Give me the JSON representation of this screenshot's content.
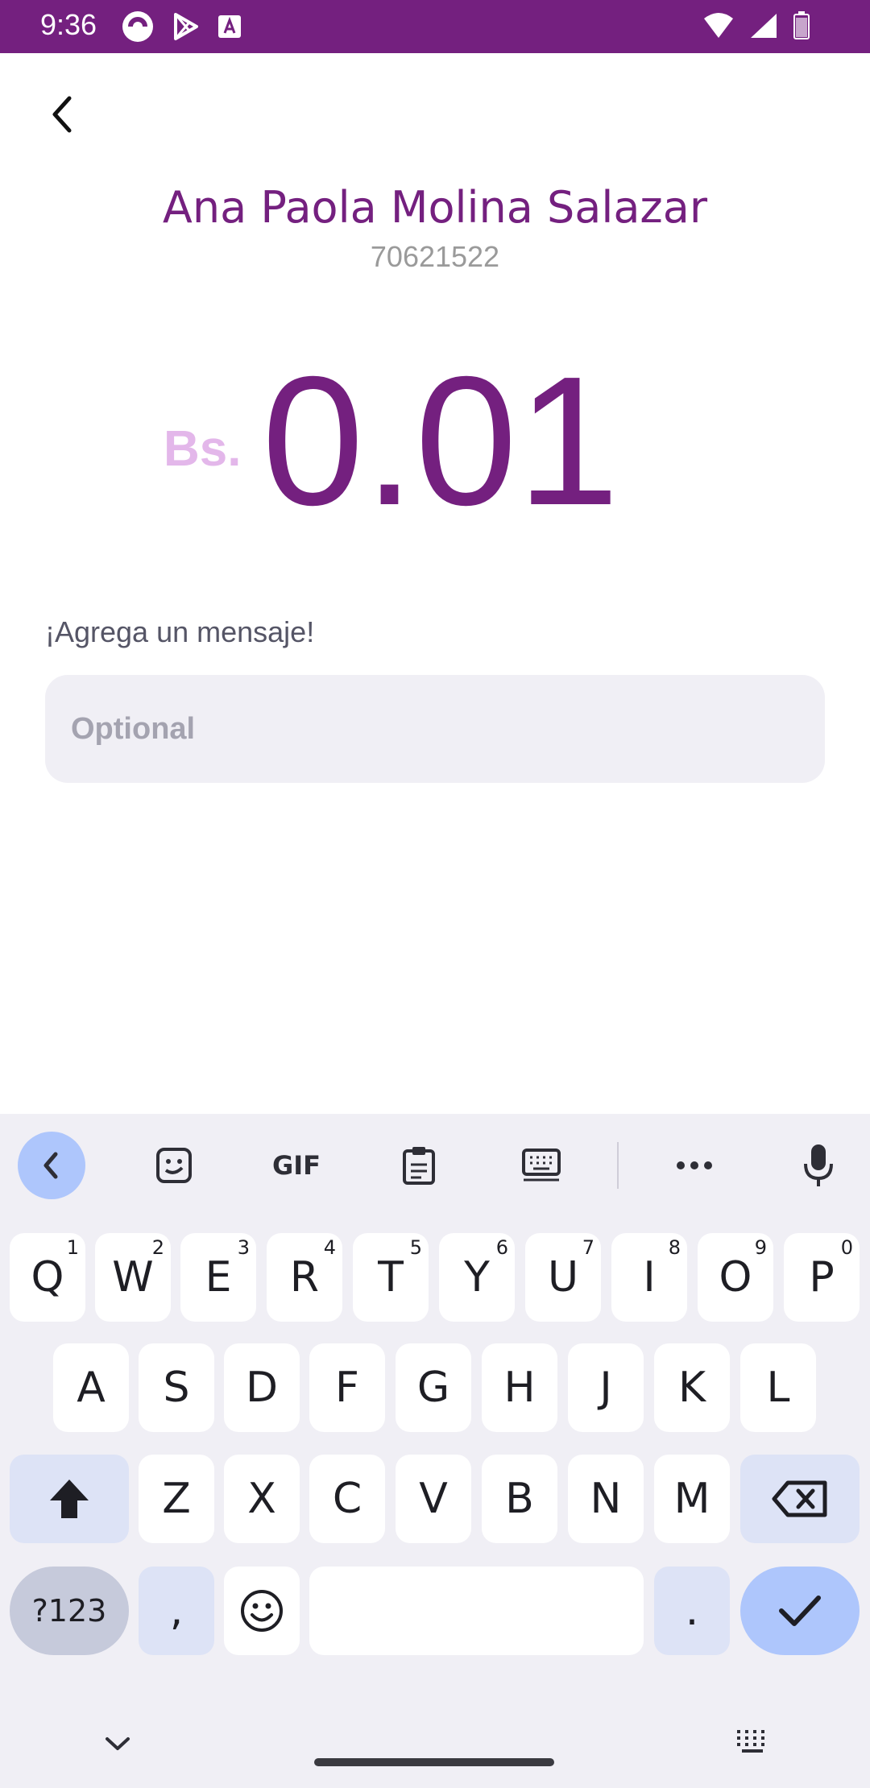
{
  "status_bar": {
    "time": "9:36",
    "bg_color": "#74207f"
  },
  "header": {
    "back_icon": "chevron-left-icon"
  },
  "recipient": {
    "name": "Ana Paola Molina Salazar",
    "phone": "70621522"
  },
  "amount": {
    "currency": "Bs.",
    "value": "0.01"
  },
  "message": {
    "label": "¡Agrega un mensaje!",
    "placeholder": "Optional",
    "value": ""
  },
  "keyboard": {
    "toolbar": [
      "back-icon",
      "sticker-icon",
      "gif-icon",
      "clipboard-icon",
      "keyboard-layout-icon",
      "more-icon",
      "mic-icon"
    ],
    "gif_label": "GIF",
    "row1": [
      {
        "key": "Q",
        "hint": "1"
      },
      {
        "key": "W",
        "hint": "2"
      },
      {
        "key": "E",
        "hint": "3"
      },
      {
        "key": "R",
        "hint": "4"
      },
      {
        "key": "T",
        "hint": "5"
      },
      {
        "key": "Y",
        "hint": "6"
      },
      {
        "key": "U",
        "hint": "7"
      },
      {
        "key": "I",
        "hint": "8"
      },
      {
        "key": "O",
        "hint": "9"
      },
      {
        "key": "P",
        "hint": "0"
      }
    ],
    "row2": [
      "A",
      "S",
      "D",
      "F",
      "G",
      "H",
      "J",
      "K",
      "L"
    ],
    "row3": [
      "Z",
      "X",
      "C",
      "V",
      "B",
      "N",
      "M"
    ],
    "mode_label": "?123",
    "comma_label": ",",
    "period_label": ".",
    "accent_color": "#aec6fc"
  }
}
